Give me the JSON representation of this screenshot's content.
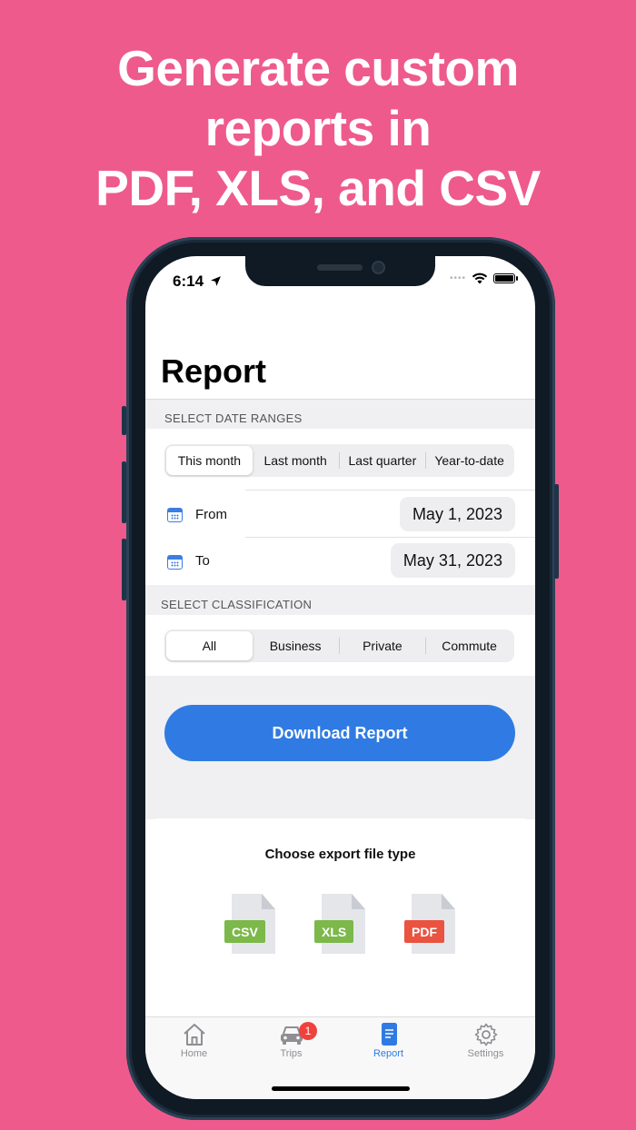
{
  "headline": [
    "Generate custom",
    "reports in",
    "PDF, XLS, and CSV"
  ],
  "status": {
    "time": "6:14"
  },
  "page_title": "Report",
  "date_section": {
    "label": "SELECT DATE RANGES",
    "ranges": [
      "This month",
      "Last month",
      "Last quarter",
      "Year-to-date"
    ],
    "selected": "This month",
    "from_label": "From",
    "from_value": "May 1, 2023",
    "to_label": "To",
    "to_value": "May 31, 2023"
  },
  "classification": {
    "label": "SELECT CLASSIFICATION",
    "options": [
      "All",
      "Business",
      "Private",
      "Commute"
    ],
    "selected": "All"
  },
  "download_label": "Download Report",
  "export": {
    "title": "Choose export file type",
    "types": [
      {
        "label": "CSV",
        "color": "#7CB84A"
      },
      {
        "label": "XLS",
        "color": "#7CB84A"
      },
      {
        "label": "PDF",
        "color": "#E95340"
      }
    ]
  },
  "tabs": [
    {
      "label": "Home",
      "icon": "house-icon"
    },
    {
      "label": "Trips",
      "icon": "car-icon",
      "badge": "1"
    },
    {
      "label": "Report",
      "icon": "document-icon"
    },
    {
      "label": "Settings",
      "icon": "gear-icon"
    }
  ],
  "colors": {
    "background": "#EE5A8C",
    "accent": "#2F7BE3"
  }
}
